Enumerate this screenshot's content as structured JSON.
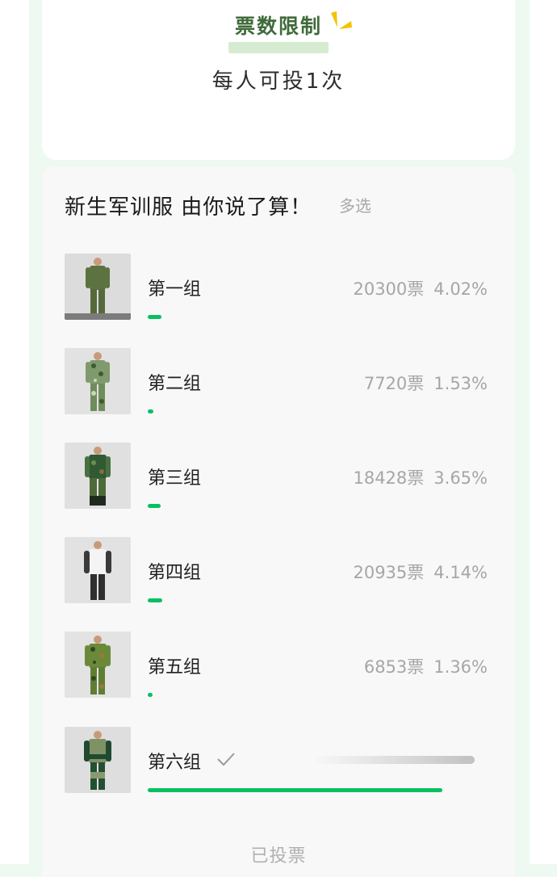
{
  "vote_limit": {
    "heading": "票数限制",
    "text": "每人可投1次"
  },
  "poll": {
    "title": "新生军训服 由你说了算！",
    "mode": "多选",
    "options": [
      {
        "label": "第一组",
        "votes": "20300票",
        "percent": "4.02%",
        "share": 0.0402
      },
      {
        "label": "第二组",
        "votes": "7720票",
        "percent": "1.53%",
        "share": 0.0153
      },
      {
        "label": "第三组",
        "votes": "18428票",
        "percent": "3.65%",
        "share": 0.0365
      },
      {
        "label": "第四组",
        "votes": "20935票",
        "percent": "4.14%",
        "share": 0.0414
      },
      {
        "label": "第五组",
        "votes": "6853票",
        "percent": "1.36%",
        "share": 0.0136
      },
      {
        "label": "第六组",
        "selected": true,
        "icon": "check-icon"
      }
    ],
    "footer": "已投票"
  },
  "colors": {
    "accent": "#07c160",
    "heading": "#3f6b3a",
    "spark": "#f2c300"
  }
}
